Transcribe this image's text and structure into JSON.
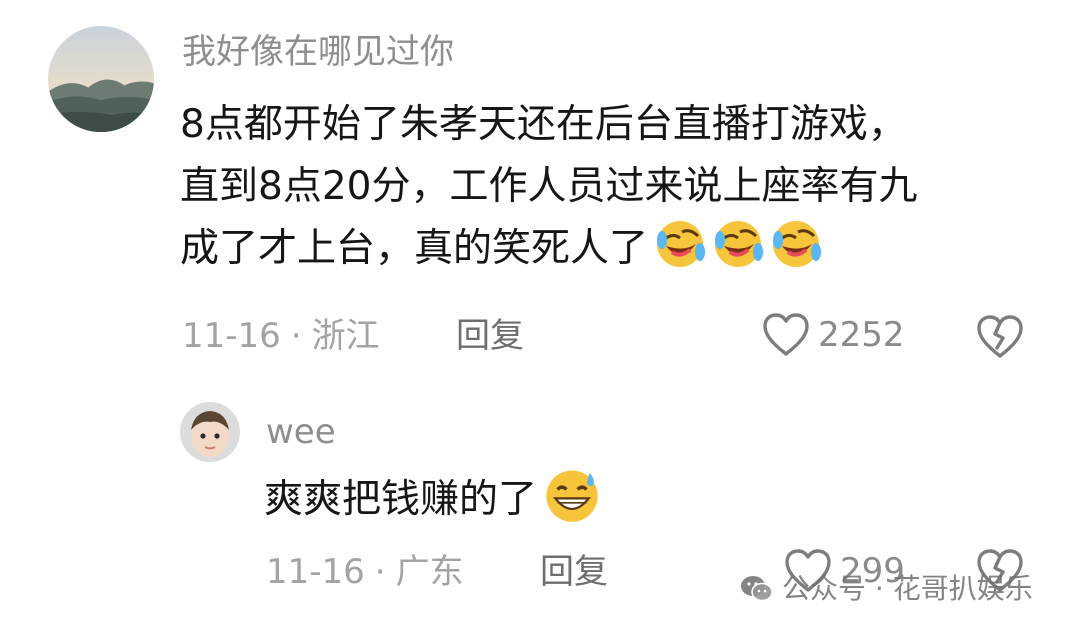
{
  "comments": [
    {
      "username": "我好像在哪见过你",
      "lines": [
        "8点都开始了朱孝天还在后台直播打游戏，",
        "直到8点20分，工作人员过来说上座率有九",
        "成了才上台，真的笑死人了"
      ],
      "emojis": [
        "rolling-laughing-emoji",
        "rolling-laughing-emoji",
        "rolling-laughing-emoji"
      ],
      "date": "11-16",
      "separator": "·",
      "location": "浙江",
      "reply_label": "回复",
      "likes": "2252"
    },
    {
      "username": "wee",
      "text": "爽爽把钱赚的了",
      "emoji": "grinning-sweat-emoji",
      "date": "11-16",
      "separator": "·",
      "location": "广东",
      "reply_label": "回复",
      "likes": "299"
    }
  ],
  "watermark": {
    "text": "公众号 · 花哥扒娱乐",
    "icon": "wechat-icon"
  },
  "colors": {
    "text": "#161616",
    "muted": "#a3a3a3",
    "emoji_yellow": "#f7c53b"
  }
}
